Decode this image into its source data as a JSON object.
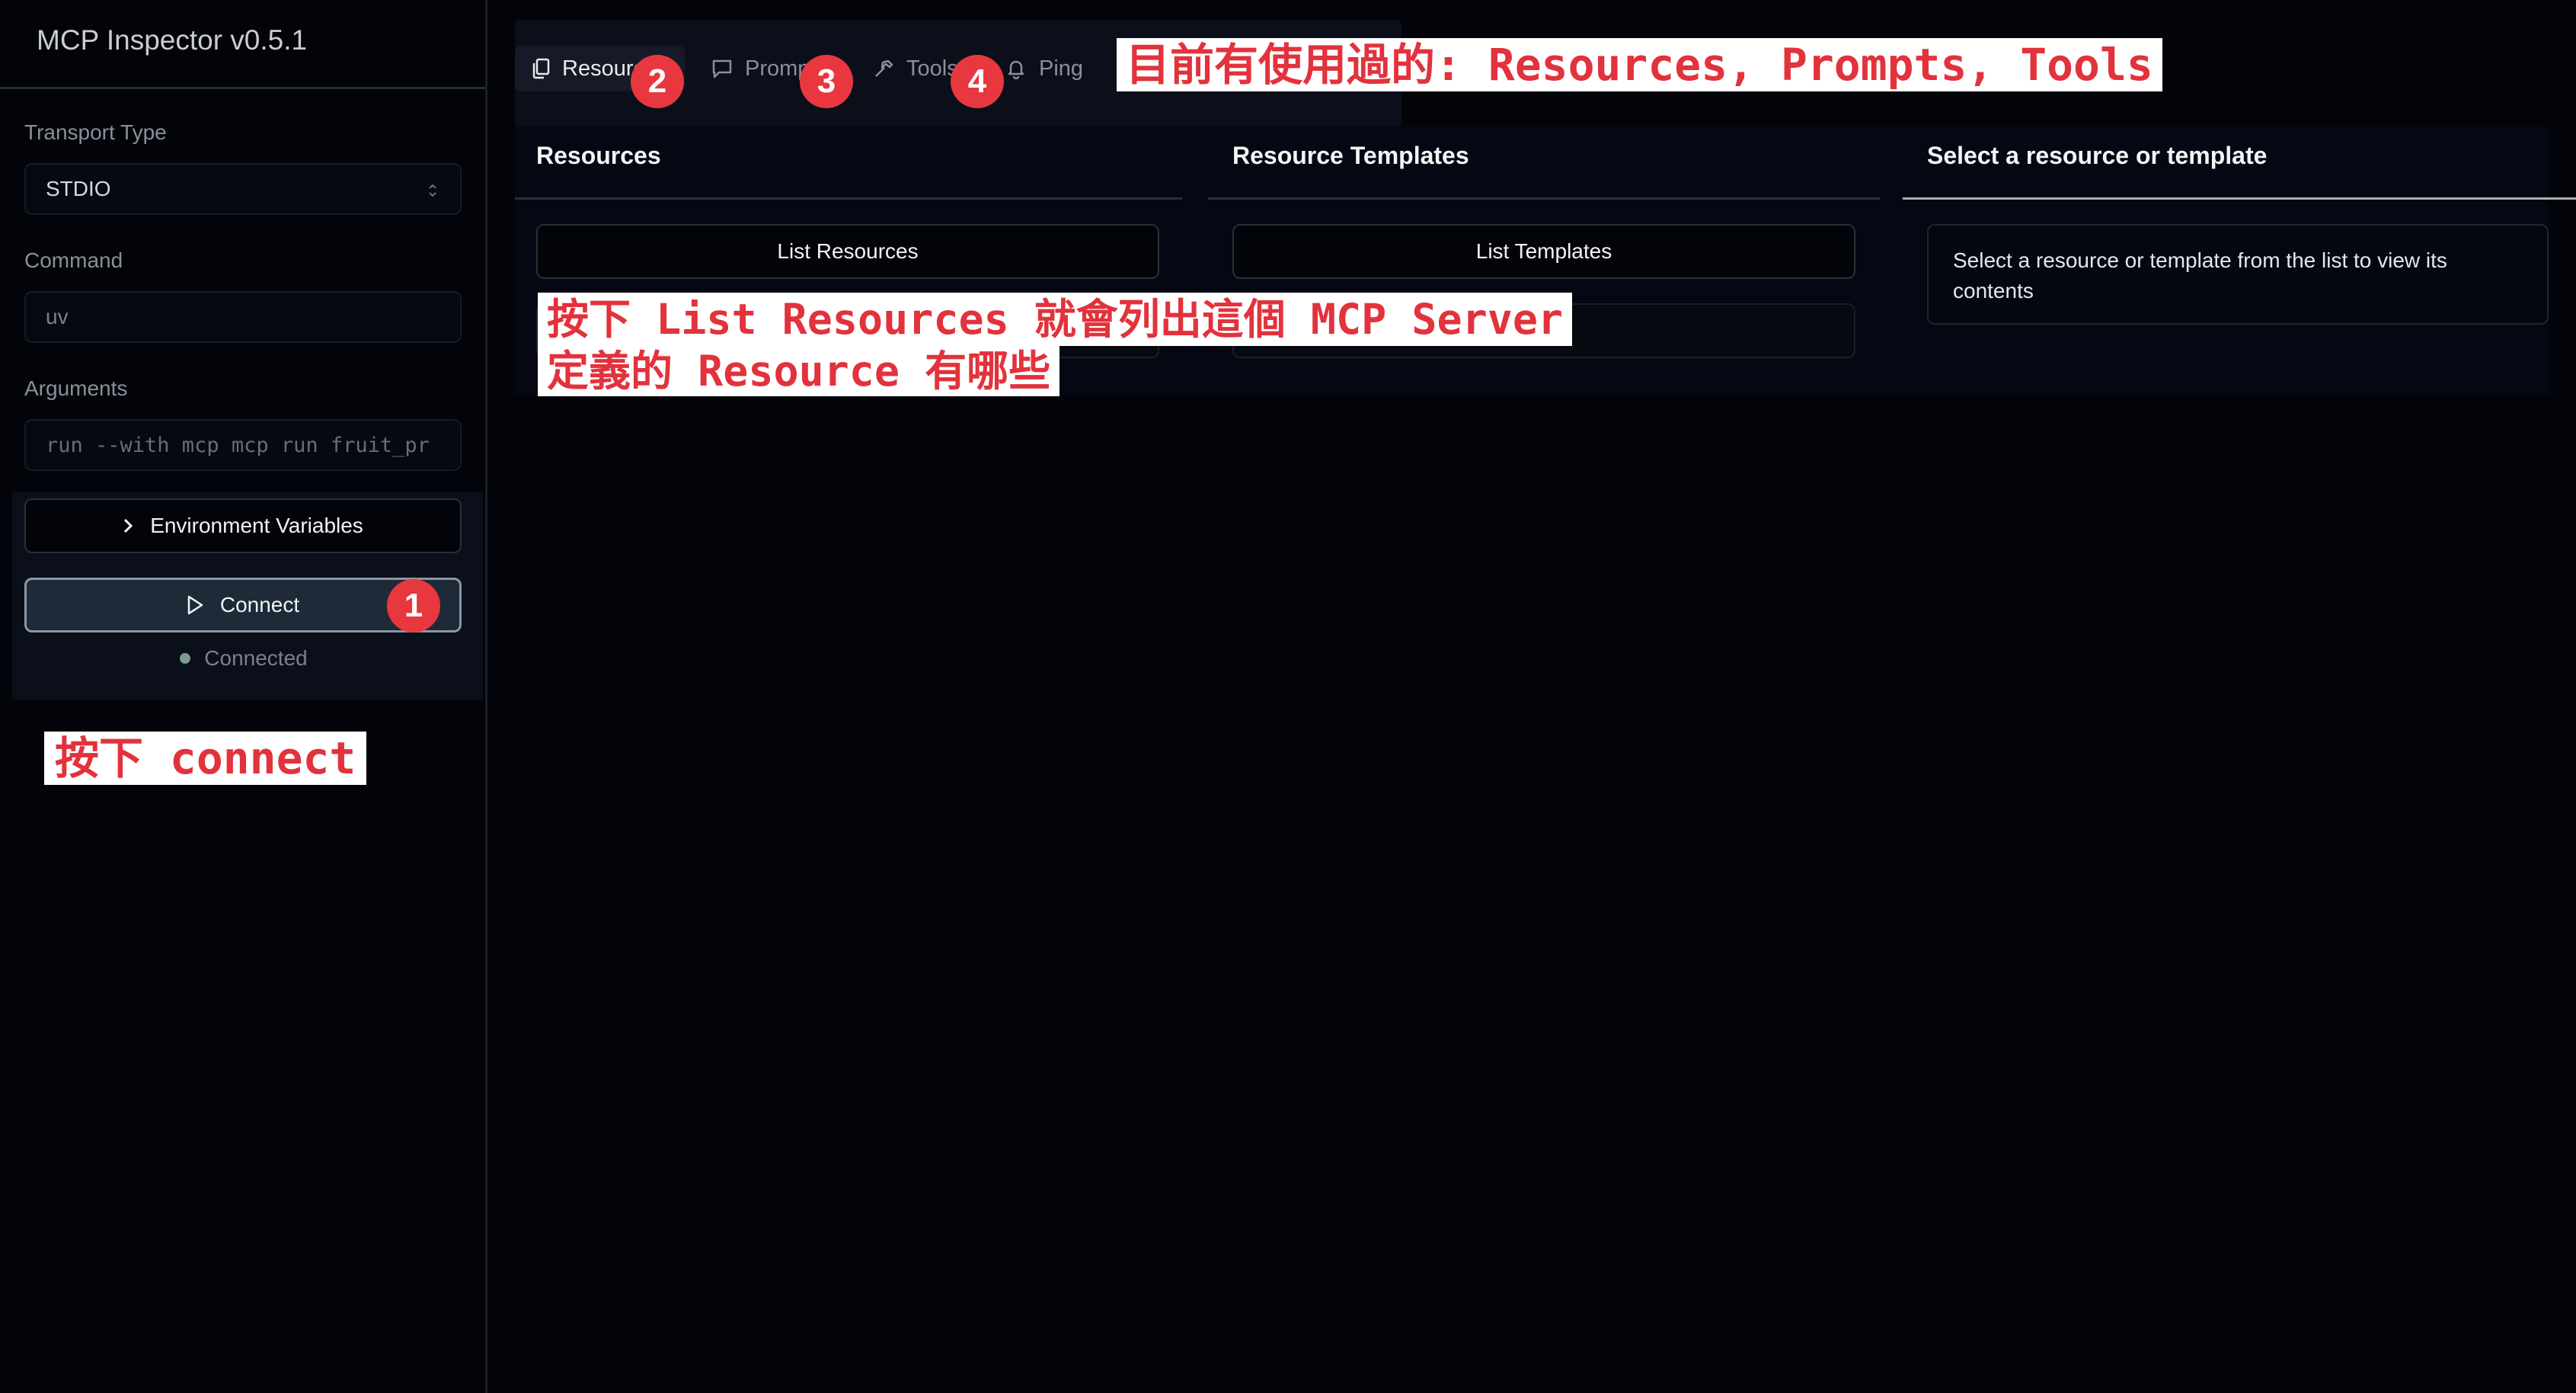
{
  "app": {
    "title": "MCP Inspector v0.5.1"
  },
  "sidebar": {
    "transport_label": "Transport Type",
    "transport_value": "STDIO",
    "command_label": "Command",
    "command_value": "uv",
    "arguments_label": "Arguments",
    "arguments_value": "run --with mcp mcp run fruit_pr",
    "env_button": "Environment Variables",
    "connect_button": "Connect",
    "status": "Connected"
  },
  "tabs": [
    {
      "label": "Resources",
      "icon": "file-copy-icon",
      "active": true
    },
    {
      "label": "Prompts",
      "icon": "message-icon",
      "active": false
    },
    {
      "label": "Tools",
      "icon": "hammer-icon",
      "active": false
    },
    {
      "label": "Ping",
      "icon": "bell-icon",
      "active": false
    }
  ],
  "panels": {
    "resources_title": "Resources",
    "list_resources_button": "List Resources",
    "templates_title": "Resource Templates",
    "list_templates_button": "List Templates",
    "detail_title": "Select a resource or template",
    "detail_text": "Select a resource or template from the list to view its contents"
  },
  "annotations": {
    "badges": [
      "1",
      "2",
      "3",
      "4"
    ],
    "note_used": "目前有使用過的: Resources, Prompts, Tools",
    "note_list_line1": "按下 List Resources 就會列出這個 MCP Server",
    "note_list_line2": "定義的 Resource 有哪些",
    "note_connect": "按下 connect"
  },
  "colors": {
    "background": "#030409",
    "annotation_red": "#e8373f",
    "accent_text": "#f1f3f6"
  }
}
